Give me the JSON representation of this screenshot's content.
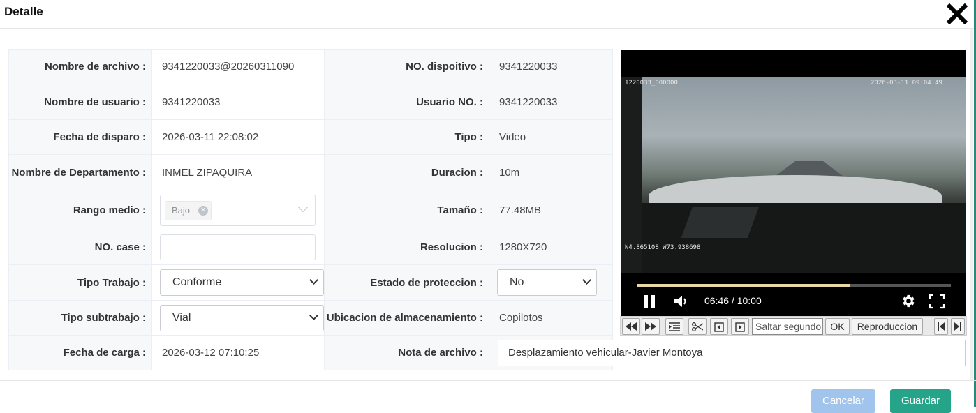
{
  "dialog": {
    "title": "Detalle"
  },
  "fields": {
    "file_name": {
      "label": "Nombre de archivo",
      "value": "9341220033@20260311090"
    },
    "device_no": {
      "label": "NO. dispoitivo",
      "value": "9341220033"
    },
    "user_name": {
      "label": "Nombre de usuario",
      "value": "9341220033"
    },
    "user_no": {
      "label": "Usuario NO.",
      "value": "9341220033"
    },
    "trigger_date": {
      "label": "Fecha de disparo",
      "value": "2026-03-11 22:08:02"
    },
    "type": {
      "label": "Tipo",
      "value": "Video"
    },
    "department": {
      "label": "Nombre de Departamento",
      "value": "INMEL ZIPAQUIRA"
    },
    "duration": {
      "label": "Duracion",
      "value": "10m"
    },
    "range": {
      "label": "Rango medio",
      "tag": "Bajo"
    },
    "size": {
      "label": "Tamaño",
      "value": "77.48MB"
    },
    "case_no": {
      "label": "NO. case",
      "value": ""
    },
    "resolution": {
      "label": "Resolucion",
      "value": "1280X720"
    },
    "work_type": {
      "label": "Tipo Trabajo",
      "value": "Conforme"
    },
    "protection": {
      "label": "Estado de proteccion",
      "value": "No"
    },
    "work_subtype": {
      "label": "Tipo subtrabajo",
      "value": "Vial"
    },
    "storage": {
      "label": "Ubicacion de almacenamiento",
      "value": "Copilotos"
    },
    "upload_date": {
      "label": "Fecha de carga",
      "value": "2026-03-12 07:10:25"
    },
    "note": {
      "label": "Nota de archivo",
      "value": "Desplazamiento vehicular-Javier Montoya"
    }
  },
  "video": {
    "osd_top_left": "1220033_000000",
    "osd_top_right": "2026-03-11 09:04:49",
    "osd_gps": "N4.865108  W73.938698",
    "time": "06:46 / 10:00",
    "progress": 0.677
  },
  "controls": {
    "seek_placeholder": "Saltar segundo",
    "ok_label": "OK",
    "play_label": "Reproduccion"
  },
  "footer": {
    "cancel_label": "Cancelar",
    "save_label": "Guardar"
  },
  "colors": {
    "accent": "#26a48a",
    "cancel": "#a0c4ec",
    "progress": "#e8d8a8"
  }
}
